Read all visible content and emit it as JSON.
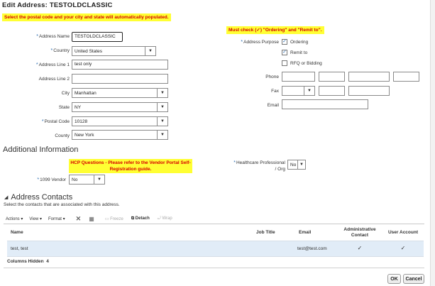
{
  "dialog": {
    "title": "Edit Address: TESTOLDCLASSIC"
  },
  "notes": {
    "postal": "Select the postal code and your city and state will automatically populated.",
    "must_check": "Must check (✓) \"Ordering\" and \"Remit to\".",
    "hcp_line1": "HCP Questions - Please refer to the Vendor Portal Self-",
    "hcp_line2": "Registration guide."
  },
  "form": {
    "address_name": {
      "label": "Address Name",
      "value": "TESTOLDCLASSIC"
    },
    "country": {
      "label": "Country",
      "value": "United States"
    },
    "address_line1": {
      "label": "Address Line 1",
      "value": "test only"
    },
    "address_line2": {
      "label": "Address Line 2",
      "value": ""
    },
    "city": {
      "label": "City",
      "value": "Manhattan"
    },
    "state": {
      "label": "State",
      "value": "NY"
    },
    "postal_code": {
      "label": "Postal Code",
      "value": "10128"
    },
    "county": {
      "label": "County",
      "value": "New York"
    }
  },
  "purpose": {
    "label": "Address Purpose",
    "options": [
      {
        "label": "Ordering",
        "checked": true
      },
      {
        "label": "Remit to",
        "checked": true
      },
      {
        "label": "RFQ or Bidding",
        "checked": false
      }
    ]
  },
  "contact": {
    "phone_label": "Phone",
    "fax_label": "Fax",
    "email_label": "Email"
  },
  "additional": {
    "heading": "Additional Information",
    "vendor_1099": {
      "label": "1099 Vendor",
      "value": "No"
    },
    "hcp_label1": "Healthcare Professional",
    "hcp_label2": "/ Org",
    "hcp_value": "No"
  },
  "contacts": {
    "heading": "Address Contacts",
    "subtitle": "Select the contacts that are associated with this address.",
    "toolbar": {
      "actions": "Actions",
      "view": "View",
      "format": "Format",
      "freeze": "Freeze",
      "detach": "Detach",
      "wrap": "Wrap"
    },
    "columns": {
      "name": "Name",
      "job_title": "Job Title",
      "email": "Email",
      "admin1": "Administrative",
      "admin2": "Contact",
      "user_account": "User Account"
    },
    "rows": [
      {
        "name": "test, test",
        "job_title": "",
        "email": "test@test.com",
        "admin": "✓",
        "user": "✓"
      }
    ],
    "columns_hidden_label": "Columns Hidden",
    "columns_hidden_count": "4"
  },
  "buttons": {
    "ok": "OK",
    "cancel": "Cancel"
  }
}
